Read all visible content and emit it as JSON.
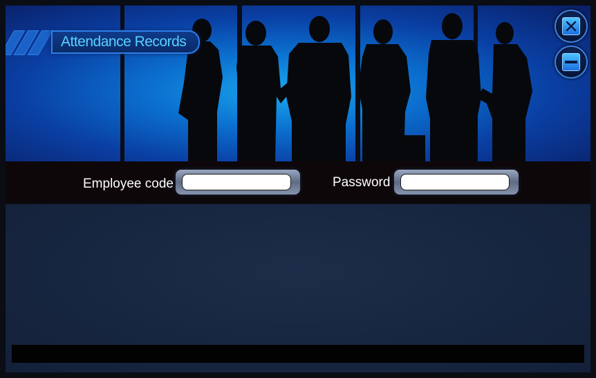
{
  "window": {
    "title": "Attendance Records",
    "close_icon": "close-icon",
    "minimize_icon": "minimize-icon"
  },
  "login": {
    "employee_code_label": "Employee code :",
    "employee_code_value": "",
    "password_label": "Password :",
    "password_value": ""
  },
  "status_bar": {
    "text": ""
  },
  "colors": {
    "banner_center": "#1aa8ee",
    "banner_edge": "#0a1f66",
    "title_text": "#58d0ff",
    "button_accent": "#4fc2ff",
    "content_bg": "#172640",
    "login_bar_bg": "#0d0709"
  }
}
